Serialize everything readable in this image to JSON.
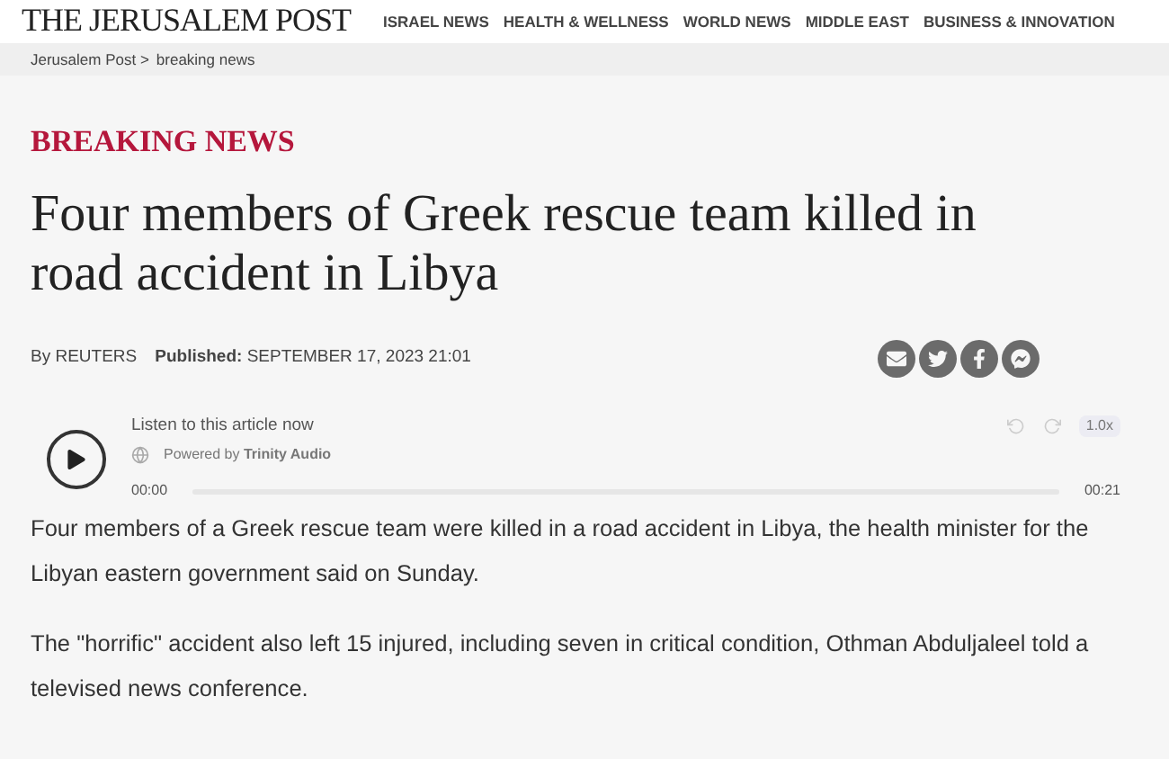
{
  "header": {
    "logo": "THE JERUSALEM POST",
    "nav": [
      "ISRAEL NEWS",
      "HEALTH & WELLNESS",
      "WORLD NEWS",
      "MIDDLE EAST",
      "BUSINESS & INNOVATION"
    ]
  },
  "breadcrumb": [
    "Jerusalem Post >",
    "breaking news"
  ],
  "category": "BREAKING NEWS",
  "headline": "Four members of Greek rescue team killed in road accident in Libya",
  "byline": "By REUTERS",
  "published": "**Published:** SEPTEMBER 17, 2023 21:01",
  "audio": {
    "title": "Listen to this article now",
    "powered": "Powered by **Trinity Audio**",
    "speed": "1.0x",
    "current": "00:00",
    "duration": "00:21",
    "level": 0
  },
  "paragraphs": [
    "Four members of a Greek rescue team were killed in a road accident in Libya, the health minister for the Libyan eastern government said on Sunday.",
    "The \"horrific\" accident also left 15 injured, including seven in critical condition, Othman Abduljaleel told a televised news conference."
  ]
}
